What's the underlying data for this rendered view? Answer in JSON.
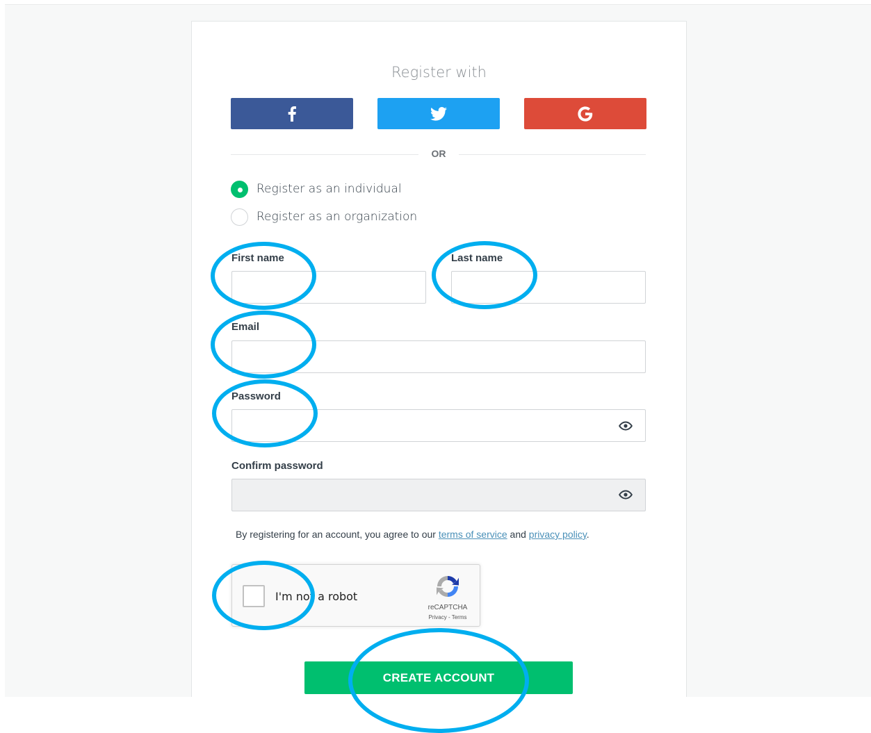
{
  "header": {
    "title": "Register with"
  },
  "social": {
    "facebook_icon": "facebook-icon",
    "twitter_icon": "twitter-icon",
    "google_icon": "google-icon",
    "colors": {
      "facebook": "#3b5998",
      "twitter": "#1da1f2",
      "google": "#dd4b39"
    }
  },
  "divider": {
    "text": "OR"
  },
  "account_type": {
    "options": [
      {
        "label": "Register as an individual",
        "selected": true
      },
      {
        "label": "Register as an organization",
        "selected": false
      }
    ]
  },
  "form": {
    "first_name": {
      "label": "First name",
      "value": ""
    },
    "last_name": {
      "label": "Last name",
      "value": ""
    },
    "email": {
      "label": "Email",
      "value": ""
    },
    "password": {
      "label": "Password",
      "value": ""
    },
    "confirm_password": {
      "label": "Confirm password",
      "value": ""
    }
  },
  "terms": {
    "prefix": "By registering for an account, you agree to our",
    "tos_link": "terms of service",
    "and": "and",
    "privacy_link": "privacy policy",
    "suffix": "."
  },
  "captcha": {
    "label": "I'm not a robot",
    "brand": "reCAPTCHA",
    "links": "Privacy - Terms",
    "checked": false
  },
  "submit": {
    "label": "CREATE ACCOUNT"
  },
  "colors": {
    "accent_green": "#00bf6f",
    "annotation_blue": "#00aeef",
    "link": "#4a90b8"
  }
}
